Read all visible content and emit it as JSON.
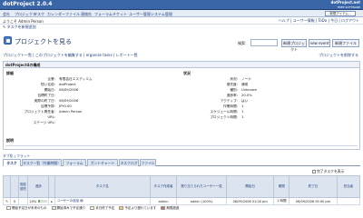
{
  "app": {
    "title": "dotProject 2.0.4",
    "logo_main": "dotProject.net",
    "logo_sub": "FREE SOFTWARE"
  },
  "menu": {
    "items": [
      "会社",
      "プロジェクト",
      "タスク",
      "カレンダー",
      "ファイル",
      "連絡先",
      "フォーラム",
      "チケット",
      "ユーザー管理",
      "システム管理"
    ],
    "new_item": "- 新規アイテム -"
  },
  "subbar": {
    "welcome": "ようこそ Admin Person",
    "links": "ヘルプ | ユーザー情報 | ToDo | 今日 | ログアウト"
  },
  "quick": {
    "add_task": "タスクを新規追加"
  },
  "project_header": {
    "title": "プロジェクトを見る",
    "find_label": "検索:",
    "find_value": "",
    "btn_new_project": "新規プロジェクト",
    "btn_new_event": "new event",
    "btn_new_file": "新規ファイル"
  },
  "breadcrumb": {
    "text": "プロジェクト一覧 | このプロジェクトを編集する | organize tasks | レポート一覧",
    "right": "プロジェクトを削除する"
  },
  "panel": {
    "title": "dotProject4の構成",
    "left_section": "詳細",
    "right_section": "状況",
    "left_rows": [
      {
        "label": "企業:",
        "value": "有限会社エスディエム"
      },
      {
        "label": "短い名前:",
        "value": "dotProject"
      },
      {
        "label": "開始日:",
        "value": "06/09/2006"
      },
      {
        "label": "目標終了日:",
        "value": ""
      },
      {
        "label": "実際の終了日:",
        "value": "06/09/2006"
      },
      {
        "label": "目標予算:",
        "value": "JPY0.00"
      },
      {
        "label": "プロジェクト責任者:",
        "value": "Admin Person"
      },
      {
        "label": "URL:",
        "value": ""
      },
      {
        "label": "ステージ URL:",
        "value": ""
      }
    ],
    "right_rows": [
      {
        "label": "状況:",
        "value": "ノード"
      },
      {
        "label": "優先度:",
        "value": "通常"
      },
      {
        "label": "種別:",
        "value": "Unknown"
      },
      {
        "label": "進捗率:",
        "value": "20.0%"
      },
      {
        "label": "アクティブ:",
        "value": "はい"
      },
      {
        "label": "作業時間:",
        "value": "1"
      },
      {
        "label": "スケジュール時間:",
        "value": "1"
      },
      {
        "label": "プロジェクト時間:",
        "value": "1"
      }
    ],
    "description_label": "説明"
  },
  "tabs": {
    "info": "タブ化 | フラット",
    "items": [
      "タスク",
      "タスク一覧（作業時間）",
      "フォーラム",
      "ガントチャート",
      "タスクログ",
      "ファイル"
    ],
    "active_index": 0,
    "filter_label": "完了タスクを表示"
  },
  "table": {
    "headers": [
      "",
      "",
      "固定\n優先",
      "進捗",
      "",
      "タスク名",
      "タスク作成者",
      "割り当てられたユーザー一覧",
      "開始日",
      "期間",
      "終了日",
      "担当者"
    ],
    "rows": [
      {
        "check": "",
        "pin": "",
        "priority": "",
        "progress": "20%",
        "progress_value": 20,
        "name": "ユーザーの追加",
        "owner": "admin",
        "assigned": "admin (100%)",
        "start": "06/09/2006 01:00 pm",
        "duration": "1 時間",
        "end": "06/09/2006 05:00 pm",
        "log": ""
      }
    ]
  },
  "legend": {
    "items": [
      {
        "label": "開始予定日が未来のもの",
        "color": "#ffffff"
      },
      {
        "label": "開始済みで予定通り",
        "color": "#e6eedd"
      },
      {
        "label": "本日終了予定",
        "color": "#ffffcc"
      },
      {
        "label": "予定より遅れています",
        "color": "#ffcc66"
      },
      {
        "label": "期限超過",
        "color": "#cc6666"
      }
    ]
  },
  "colors": {
    "header_bg": "#3a66a8",
    "menu_bg": "#e6ecf5",
    "panel_border": "#b8c6da",
    "accent_text": "#1d3f7a"
  }
}
